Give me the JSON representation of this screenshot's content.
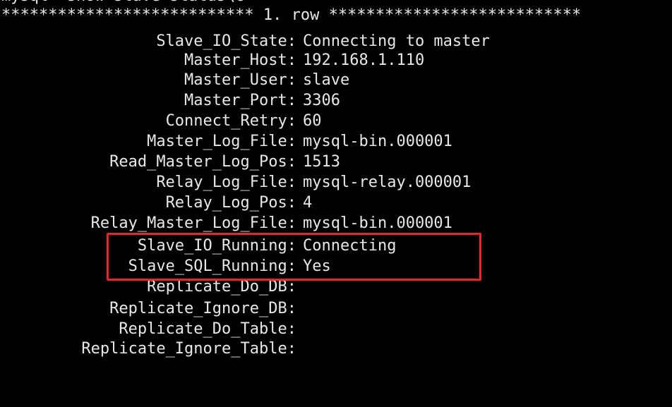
{
  "terminal": {
    "command_line": "mysql> show slave status\\G",
    "row_header": "*************************** 1. row ***************************",
    "fields": [
      {
        "key": "Slave_IO_State",
        "value": "Connecting to master"
      },
      {
        "key": "Master_Host",
        "value": "192.168.1.110"
      },
      {
        "key": "Master_User",
        "value": "slave"
      },
      {
        "key": "Master_Port",
        "value": "3306"
      },
      {
        "key": "Connect_Retry",
        "value": "60"
      },
      {
        "key": "Master_Log_File",
        "value": "mysql-bin.000001"
      },
      {
        "key": "Read_Master_Log_Pos",
        "value": "1513"
      },
      {
        "key": "Relay_Log_File",
        "value": "mysql-relay.000001"
      },
      {
        "key": "Relay_Log_Pos",
        "value": "4"
      },
      {
        "key": "Relay_Master_Log_File",
        "value": "mysql-bin.000001"
      },
      {
        "key": "Slave_IO_Running",
        "value": "Connecting"
      },
      {
        "key": "Slave_SQL_Running",
        "value": "Yes"
      },
      {
        "key": "Replicate_Do_DB",
        "value": ""
      },
      {
        "key": "Replicate_Ignore_DB",
        "value": ""
      },
      {
        "key": "Replicate_Do_Table",
        "value": ""
      },
      {
        "key": "Replicate_Ignore_Table",
        "value": ""
      }
    ]
  },
  "colors": {
    "background": "#000000",
    "text": "#e8e8e8",
    "highlight_border": "#e8262b"
  }
}
